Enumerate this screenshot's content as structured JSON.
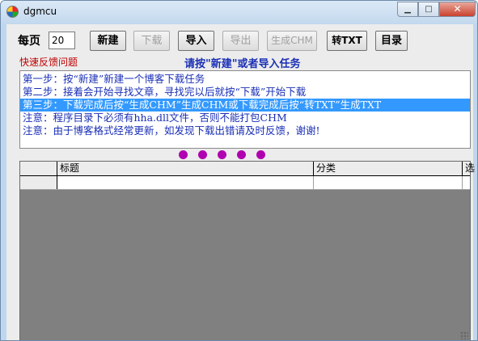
{
  "window": {
    "title": "dgmcu",
    "minimize_glyph": "▁",
    "maximize_glyph": "□",
    "close_glyph": "✕"
  },
  "toolbar": {
    "per_page_label": "每页",
    "per_page_value": "20",
    "buttons": {
      "new": "新建",
      "download": "下载",
      "import": "导入",
      "export": "导出",
      "gen_chm": "生成CHM",
      "to_txt": "转TXT",
      "catalog": "目录"
    }
  },
  "feedback_link": "快速反馈问题",
  "hint": "请按\"新建\"或者导入任务",
  "steps": [
    "第一步：按“新建”新建一个博客下载任务",
    "第二步：接着会开始寻找文章，寻找完以后就按“下载”开始下载",
    "第三步：下载完成后按“生成CHM”生成CHM或下载完成后按“转TXT”生成TXT",
    "注意：程序目录下必须有hha.dll文件，否则不能打包CHM",
    "注意：由于博客格式经常更新，如发现下载出错请及时反馈，谢谢!"
  ],
  "selected_step_index": 2,
  "grid": {
    "columns": [
      "",
      "标题",
      "分类",
      "选"
    ]
  },
  "colors": {
    "hint": "#1a2fb5",
    "feedback": "#c00000",
    "selection": "#3399ff",
    "dots": "#b000b0",
    "grid_bg": "#808080"
  },
  "icons": {
    "app": "app-icon",
    "grip": "resize-grip-icon"
  }
}
